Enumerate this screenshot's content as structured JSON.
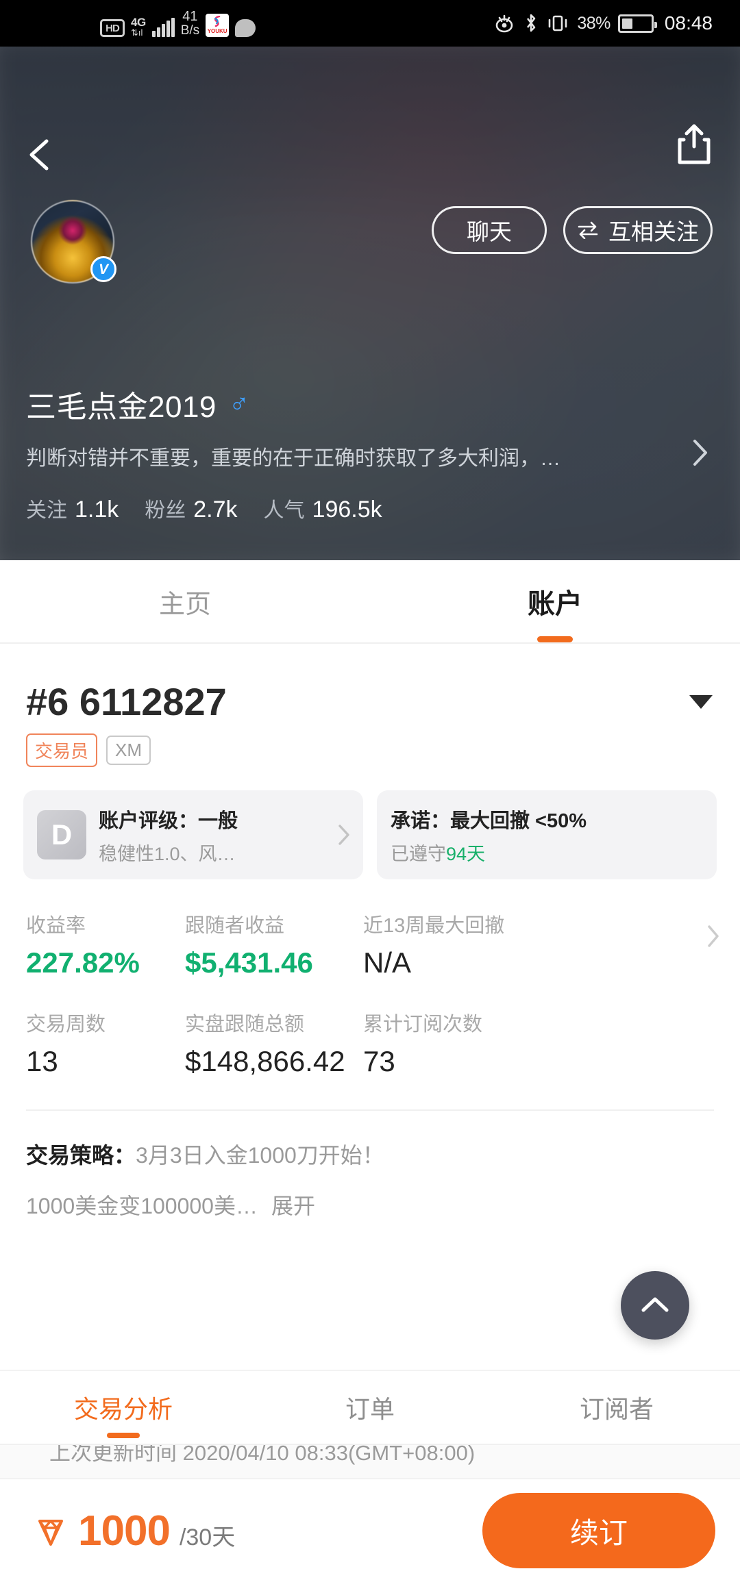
{
  "statusbar": {
    "hd": "HD",
    "network_gen": "4G",
    "speed_value": "41",
    "speed_unit": "B/s",
    "youku_label": "YOUKU",
    "battery_percent": "38%",
    "time": "08:48"
  },
  "header": {
    "chat_button": "聊天",
    "follow_button": "互相关注",
    "username": "三毛点金2019",
    "gender_symbol": "♂",
    "bio": "判断对错并不重要，重要的在于正确时获取了多大利润，…",
    "counts": [
      {
        "label": "关注",
        "value": "1.1k"
      },
      {
        "label": "粉丝",
        "value": "2.7k"
      },
      {
        "label": "人气",
        "value": "196.5k"
      }
    ]
  },
  "top_tabs": [
    {
      "label": "主页",
      "active": false
    },
    {
      "label": "账户",
      "active": true
    }
  ],
  "account": {
    "number": "#6 6112827",
    "badges": [
      {
        "label": "交易员",
        "style": "trader"
      },
      {
        "label": "XM",
        "style": "broker"
      }
    ]
  },
  "cards": {
    "rating": {
      "grade": "D",
      "title": "账户评级：一般",
      "subtitle": "稳健性1.0、风…"
    },
    "promise": {
      "title": "承诺：最大回撤 <50%",
      "sub_prefix": "已遵守",
      "sub_highlight": "94天"
    }
  },
  "stats": {
    "row1": [
      {
        "label": "收益率",
        "value": "227.82%",
        "green": true
      },
      {
        "label": "跟随者收益",
        "value": "$5,431.46",
        "green": true
      },
      {
        "label": "近13周最大回撤",
        "value": "N/A",
        "green": false
      }
    ],
    "row2": [
      {
        "label": "交易周数",
        "value": "13"
      },
      {
        "label": "实盘跟随总额",
        "value": "$148,866.42"
      },
      {
        "label": "累计订阅次数",
        "value": "73"
      }
    ]
  },
  "strategy": {
    "title": "交易策略：",
    "text": "3月3日入金1000刀开始！",
    "preview": "1000美金变100000美…",
    "expand": "展开"
  },
  "bottom_tabs": [
    {
      "label": "交易分析",
      "active": true
    },
    {
      "label": "订单",
      "active": false
    },
    {
      "label": "订阅者",
      "active": false
    }
  ],
  "updated": "上次更新时间 2020/04/10 08:33(GMT+08:00)",
  "bottombar": {
    "price": "1000",
    "period": "/30天",
    "renew_label": "续订"
  },
  "colors": {
    "accent_orange": "#f26b1d",
    "green": "#11b070",
    "badge_orange": "#f0845a",
    "verified_blue": "#2196f3",
    "gender_blue": "#3fa0ff",
    "fab_dark": "#4d505e"
  }
}
